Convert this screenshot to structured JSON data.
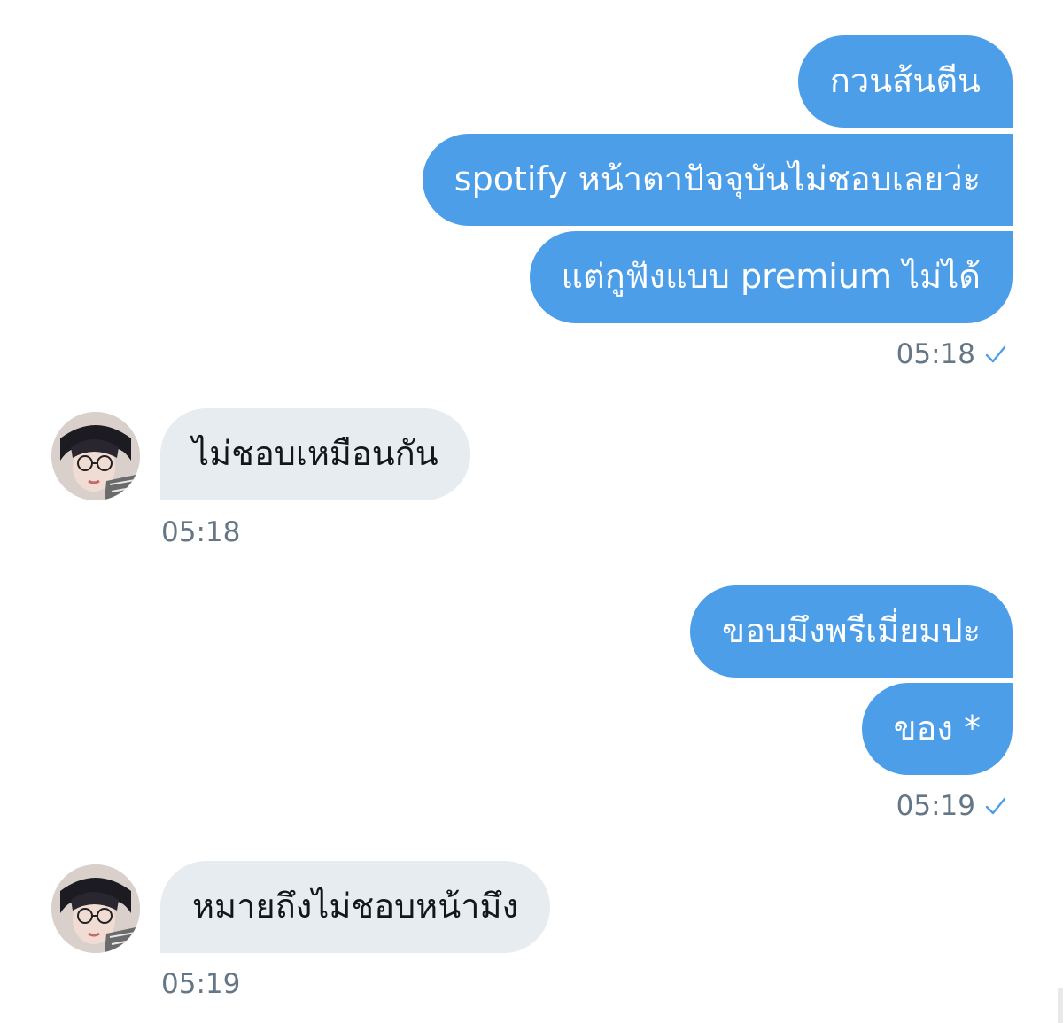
{
  "groups": [
    {
      "side": "out",
      "messages": [
        "กวนส้นตีน",
        "spotify หน้าตาปัจจุบันไม่ชอบเลยว่ะ",
        "แต่กูฟังแบบ premium ไม่ได้"
      ],
      "time": "05:18",
      "status_icon": "check-icon"
    },
    {
      "side": "in",
      "avatar_icon": "avatar",
      "messages": [
        "ไม่ชอบเหมือนกัน"
      ],
      "time": "05:18"
    },
    {
      "side": "out",
      "messages": [
        "ขอบมึงพรีเมี่ยมปะ",
        "ของ *"
      ],
      "time": "05:19",
      "status_icon": "check-icon"
    },
    {
      "side": "in",
      "avatar_icon": "avatar",
      "messages": [
        "หมายถึงไม่ชอบหน้ามึง"
      ],
      "time": "05:19"
    }
  ],
  "colors": {
    "outgoing_bubble": "#4c9ee9",
    "incoming_bubble": "#e6ecf0",
    "timestamp": "#657786",
    "check": "#4c9ee9"
  }
}
